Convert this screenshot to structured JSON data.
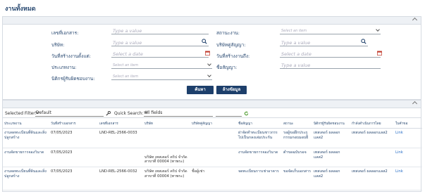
{
  "page": {
    "title": "งานทั้งหมด"
  },
  "search": {
    "fields": {
      "doc_no": {
        "label": "เลขที่เอกสาร:",
        "placeholder": "Type a value"
      },
      "status": {
        "label": "สถานะงาน:",
        "placeholder": "Select an item"
      },
      "company": {
        "label": "บริษัท:",
        "placeholder": "Type a value"
      },
      "contract_company": {
        "label": "บริษัทคู่สัญญา:",
        "placeholder": "Type a value"
      },
      "created_start": {
        "label": "วันที่สร้างงานตั้งแต่:",
        "placeholder": "Select a date"
      },
      "created_end": {
        "label": "วันที่สร้างงานถึง:",
        "placeholder": "Select a date"
      },
      "job_type": {
        "label": "ประเภทงาน:",
        "placeholder": "Select an item"
      },
      "contract_name": {
        "label": "ชื่อสัญญา:",
        "placeholder": "Type a value"
      },
      "legal_officer": {
        "label": "นิติกรผู้รับผิดชอบงาน:",
        "placeholder": "Select an item"
      }
    },
    "search_button": "ค้นหา",
    "clear_button": "ล้างข้อมูล"
  },
  "results": {
    "toolbar": {
      "selected_filter_label": "Selected Filter:",
      "selected_filter_value": "Default",
      "quick_search_label": "Quick Search:",
      "quick_search_value": "All fields"
    },
    "columns": [
      "ประเภทงาน",
      "วันที่สร้างเอกสาร",
      "เลขที่เอกสาร",
      "บริษัท",
      "บริษัทคู่สัญญา",
      "ชื่อสัญญา",
      "สถานะ",
      "นิติกรผู้รับผิดชอบงาน",
      "กำลังดำเนินการโดย",
      "ใบคำขอ"
    ],
    "rows": [
      {
        "job_type": "งานจดทะเบียนที่ดินและสิ่งปลูกสร้าง",
        "created": "07/05/2023",
        "doc_no": "LND-REL-2566-0033",
        "company": "",
        "contract_company": "",
        "contract_name": "ฝาจัดทำทะเบียนชาวกรรไปเป็นกลงเล่มประกัน",
        "status": "รอผู้ขอฝึกประกูกรรมกอบมอบฝี",
        "officer": "เทสเตอร์ ผลลอกแลส2",
        "processing": "เทสเตอร์ ผลลอกแลส2",
        "link": "Link"
      },
      {
        "job_type": "งานจัดขายการจองวินาด",
        "created": "07/05/2023",
        "doc_no": "",
        "company": "",
        "contract_company": "",
        "contract_name": "งานจัดขายการจองวินาด",
        "status": "ตำขอฉบับรอจ",
        "officer": "เทสเตอร์ ผลลอกแลส2",
        "processing": "",
        "link": "Link"
      },
      {
        "job_type": "งานจดทะเบียนที่ดินและสิ่งปลูกสร้าง",
        "created": "07/05/2023",
        "doc_no": "LND-REL-2566-0032",
        "company": "บริษัท เทสเตอร์ คริป จำกัด สาขาที่ 00004 (ทาพระ)",
        "contract_company": "ชื่อผู้เช่า",
        "contract_name": "จดทะเบียนการเช่าอาคาร",
        "status": "ขอจัดเก็บเอกสาร",
        "officer": "เทสเตอร์ ผลลอกแลส2",
        "processing": "เทสเตอร์ ผลลอกแลส2",
        "link": "Link"
      }
    ],
    "row2_company_extra": "บริษัท เทสเตอร์ คริป จำกัด สาขาที่ 00004 (ทาพระ)"
  }
}
